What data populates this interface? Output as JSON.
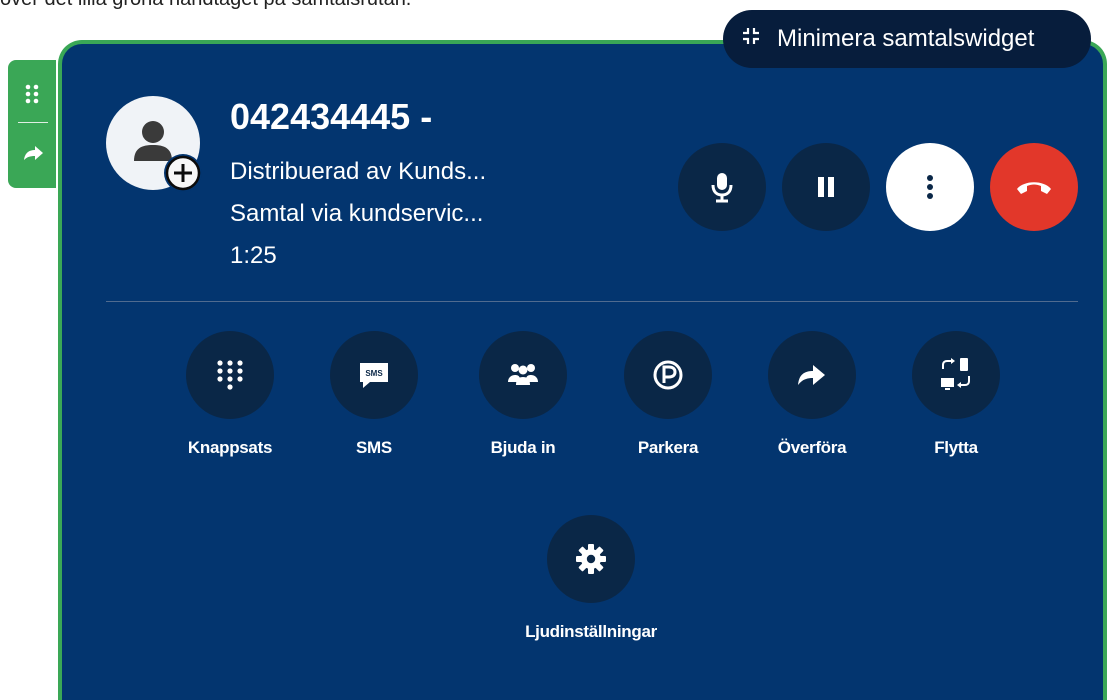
{
  "top_instruction": "över det lilla gröna handtaget på samtalsrutan.",
  "widget": {
    "minimize_label": "Minimera samtalswidget",
    "caller": {
      "number": "042434445 -",
      "line1": "Distribuerad av Kunds...",
      "line2": "Samtal via kundservic...",
      "duration": "1:25"
    },
    "controls": [
      {
        "name": "mute",
        "icon": "microphone-icon"
      },
      {
        "name": "hold",
        "icon": "pause-icon"
      },
      {
        "name": "more",
        "icon": "more-vertical-icon"
      },
      {
        "name": "hangup",
        "icon": "hangup-icon"
      }
    ],
    "actions": [
      {
        "label": "Knappsats",
        "icon": "dialpad-icon"
      },
      {
        "label": "SMS",
        "icon": "sms-icon"
      },
      {
        "label": "Bjuda in",
        "icon": "people-icon"
      },
      {
        "label": "Parkera",
        "icon": "parking-icon"
      },
      {
        "label": "Överföra",
        "icon": "transfer-icon"
      },
      {
        "label": "Flytta",
        "icon": "move-device-icon"
      }
    ],
    "settings_label": "Ljudinställningar"
  },
  "colors": {
    "panel": "#03356f",
    "green": "#3aa756",
    "hangup": "#e2372a"
  }
}
